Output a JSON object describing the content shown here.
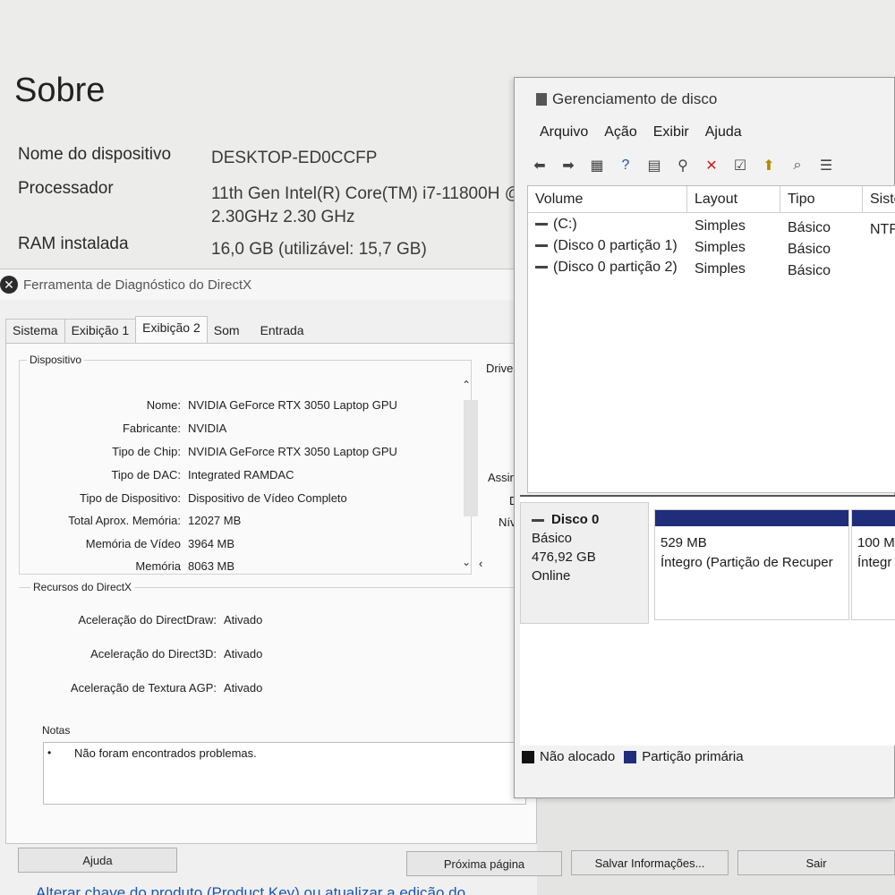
{
  "sobre": {
    "title": "Sobre",
    "rows": [
      {
        "label": "Nome do dispositivo",
        "value": "DESKTOP-ED0CCFP"
      },
      {
        "label": "Processador",
        "value": "11th Gen Intel(R) Core(TM) i7-11800H @",
        "value2": "2.30GHz   2.30 GHz"
      },
      {
        "label": "RAM instalada",
        "value": "16,0 GB (utilizável: 15,7 GB)"
      }
    ],
    "footer_link": "Alterar chave do produto (Product Key) ou atualizar a edição do"
  },
  "dxdiag": {
    "title": "Ferramenta de Diagnóstico do DirectX",
    "tabs": [
      "Sistema",
      "Exibição 1",
      "Exibição 2",
      "Som",
      "Entrada"
    ],
    "active_tab": "Exibição 2",
    "device_group": "Dispositivo",
    "device": [
      {
        "k": "Nome:",
        "v": "NVIDIA GeForce RTX 3050 Laptop GPU"
      },
      {
        "k": "Fabricante:",
        "v": "NVIDIA"
      },
      {
        "k": "Tipo de Chip:",
        "v": "NVIDIA GeForce RTX 3050 Laptop GPU"
      },
      {
        "k": "Tipo de DAC:",
        "v": "Integrated RAMDAC"
      },
      {
        "k": "Tipo de Dispositivo:",
        "v": "Dispositivo de Vídeo Completo"
      },
      {
        "k": "Total Aprox. Memória:",
        "v": "12027 MB"
      },
      {
        "k": "Memória de Vídeo",
        "v": "3964 MB"
      },
      {
        "k": "Memória",
        "v": "8063 MB"
      }
    ],
    "right_labels": [
      "Drivers",
      "D",
      "Assina",
      "D",
      "Níve"
    ],
    "resources_group": "Recursos do DirectX",
    "resources": [
      {
        "k": "Aceleração do DirectDraw:",
        "v": "Ativado"
      },
      {
        "k": "Aceleração do Direct3D:",
        "v": "Ativado"
      },
      {
        "k": "Aceleração de Textura AGP:",
        "v": "Ativado"
      }
    ],
    "notes_group": "Notas",
    "notes": "Não foram encontrados problemas.",
    "buttons": {
      "help": "Ajuda",
      "next": "Próxima página",
      "save": "Salvar Informações...",
      "exit": "Sair"
    }
  },
  "diskmgmt": {
    "title": "Gerenciamento de disco",
    "menu": [
      "Arquivo",
      "Ação",
      "Exibir",
      "Ajuda"
    ],
    "columns": [
      "Volume",
      "Layout",
      "Tipo",
      "Siste"
    ],
    "volumes": [
      {
        "volume": "(C:)",
        "layout": "Simples",
        "tipo": "Básico",
        "fs": "NTF"
      },
      {
        "volume": "(Disco 0 partição 1)",
        "layout": "Simples",
        "tipo": "Básico",
        "fs": ""
      },
      {
        "volume": "(Disco 0 partição 2)",
        "layout": "Simples",
        "tipo": "Básico",
        "fs": ""
      }
    ],
    "disk": {
      "name": "Disco 0",
      "type": "Básico",
      "size": "476,92 GB",
      "status": "Online"
    },
    "partitions": [
      {
        "size": "529 MB",
        "status": "Íntegro (Partição de Recuper"
      },
      {
        "size": "100 M",
        "status": "Íntegr"
      }
    ],
    "legend": [
      {
        "label": "Não alocado",
        "color": "#111111"
      },
      {
        "label": "Partição primária",
        "color": "#1f2d7a"
      }
    ]
  }
}
